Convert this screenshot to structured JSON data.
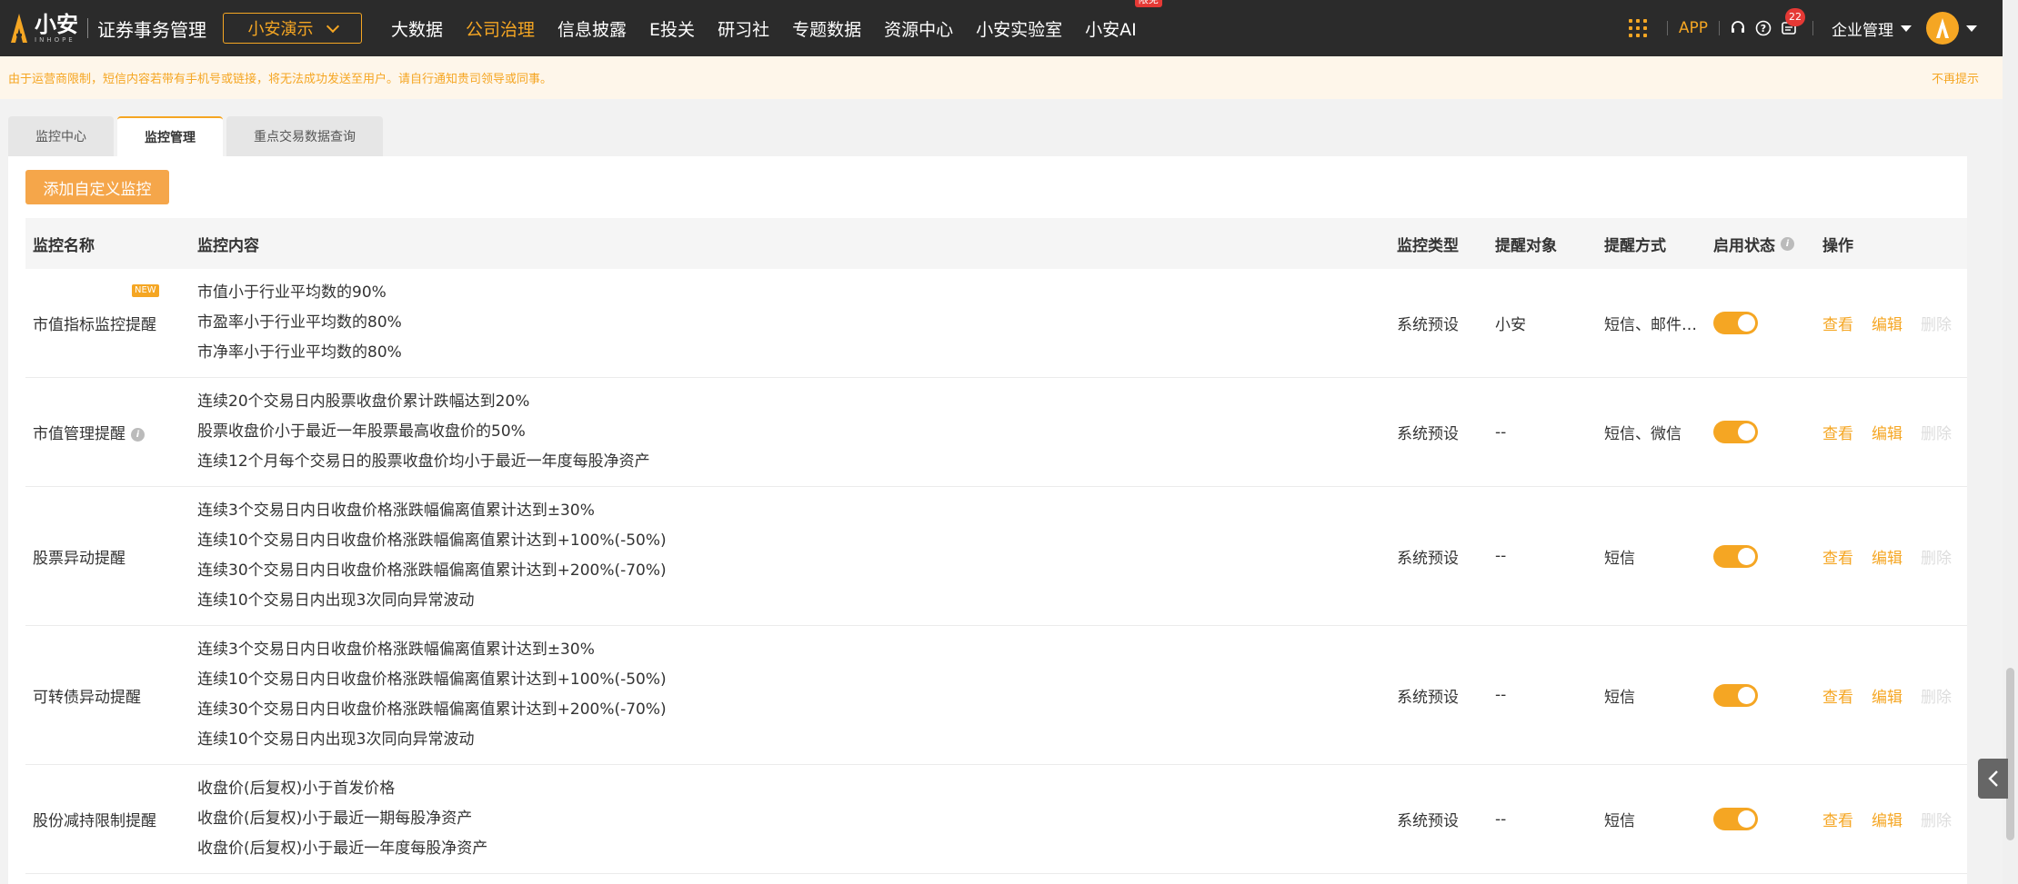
{
  "brand": {
    "name": "小安",
    "sub": "INHOPE",
    "app_title": "证券事务管理"
  },
  "company_selector": {
    "value": "小安演示"
  },
  "nav": [
    {
      "label": "大数据",
      "active": false
    },
    {
      "label": "公司治理",
      "active": true
    },
    {
      "label": "信息披露",
      "active": false
    },
    {
      "label": "E投关",
      "active": false
    },
    {
      "label": "研习社",
      "active": false
    },
    {
      "label": "专题数据",
      "active": false
    },
    {
      "label": "资源中心",
      "active": false
    },
    {
      "label": "小安实验室",
      "active": false
    },
    {
      "label": "小安AI",
      "active": false,
      "badge": "限免"
    }
  ],
  "topbar_right": {
    "app_label": "APP",
    "message_count": "22",
    "enterprise_label": "企业管理"
  },
  "notice": {
    "text": "由于运营商限制，短信内容若带有手机号或链接，将无法成功发送至用户。请自行通知贵司领导或同事。",
    "dismiss": "不再提示"
  },
  "tabs": [
    {
      "label": "监控中心",
      "active": false
    },
    {
      "label": "监控管理",
      "active": true
    },
    {
      "label": "重点交易数据查询",
      "active": false
    }
  ],
  "add_button": "添加自定义监控",
  "table": {
    "headers": {
      "name": "监控名称",
      "content": "监控内容",
      "type": "监控类型",
      "target": "提醒对象",
      "method": "提醒方式",
      "status": "启用状态",
      "ops": "操作"
    },
    "ops": {
      "view": "查看",
      "edit": "编辑",
      "delete": "删除"
    },
    "new_badge": "NEW",
    "rows": [
      {
        "name": "市值指标监控提醒",
        "content": [
          "市值小于行业平均数的90%",
          "市盈率小于行业平均数的80%",
          "市净率小于行业平均数的80%"
        ],
        "type": "系统预设",
        "target": "小安",
        "method": "短信、邮件、微信",
        "enabled": true
      },
      {
        "name": "市值管理提醒",
        "content": [
          "连续20个交易日内股票收盘价累计跌幅达到20%",
          "股票收盘价小于最近一年股票最高收盘价的50%",
          "连续12个月每个交易日的股票收盘价均小于最近一年度每股净资产"
        ],
        "type": "系统预设",
        "target": "--",
        "method": "短信、微信",
        "enabled": true
      },
      {
        "name": "股票异动提醒",
        "content": [
          "连续3个交易日内日收盘价格涨跌幅偏离值累计达到±30%",
          "连续10个交易日内日收盘价格涨跌幅偏离值累计达到+100%(-50%)",
          "连续30个交易日内日收盘价格涨跌幅偏离值累计达到+200%(-70%)",
          "连续10个交易日内出现3次同向异常波动"
        ],
        "type": "系统预设",
        "target": "--",
        "method": "短信",
        "enabled": true
      },
      {
        "name": "可转债异动提醒",
        "content": [
          "连续3个交易日内日收盘价格涨跌幅偏离值累计达到±30%",
          "连续10个交易日内日收盘价格涨跌幅偏离值累计达到+100%(-50%)",
          "连续30个交易日内日收盘价格涨跌幅偏离值累计达到+200%(-70%)",
          "连续10个交易日内出现3次同向异常波动"
        ],
        "type": "系统预设",
        "target": "--",
        "method": "短信",
        "enabled": true
      },
      {
        "name": "股份减持限制提醒",
        "content": [
          "收盘价(后复权)小于首发价格",
          "收盘价(后复权)小于最近一期每股净资产",
          "收盘价(后复权)小于最近一年度每股净资产"
        ],
        "type": "系统预设",
        "target": "--",
        "method": "短信",
        "enabled": true
      }
    ]
  },
  "colors": {
    "accent": "#f5a623",
    "topbar": "#2b2b2b",
    "notice_bg": "#fef6ea"
  }
}
